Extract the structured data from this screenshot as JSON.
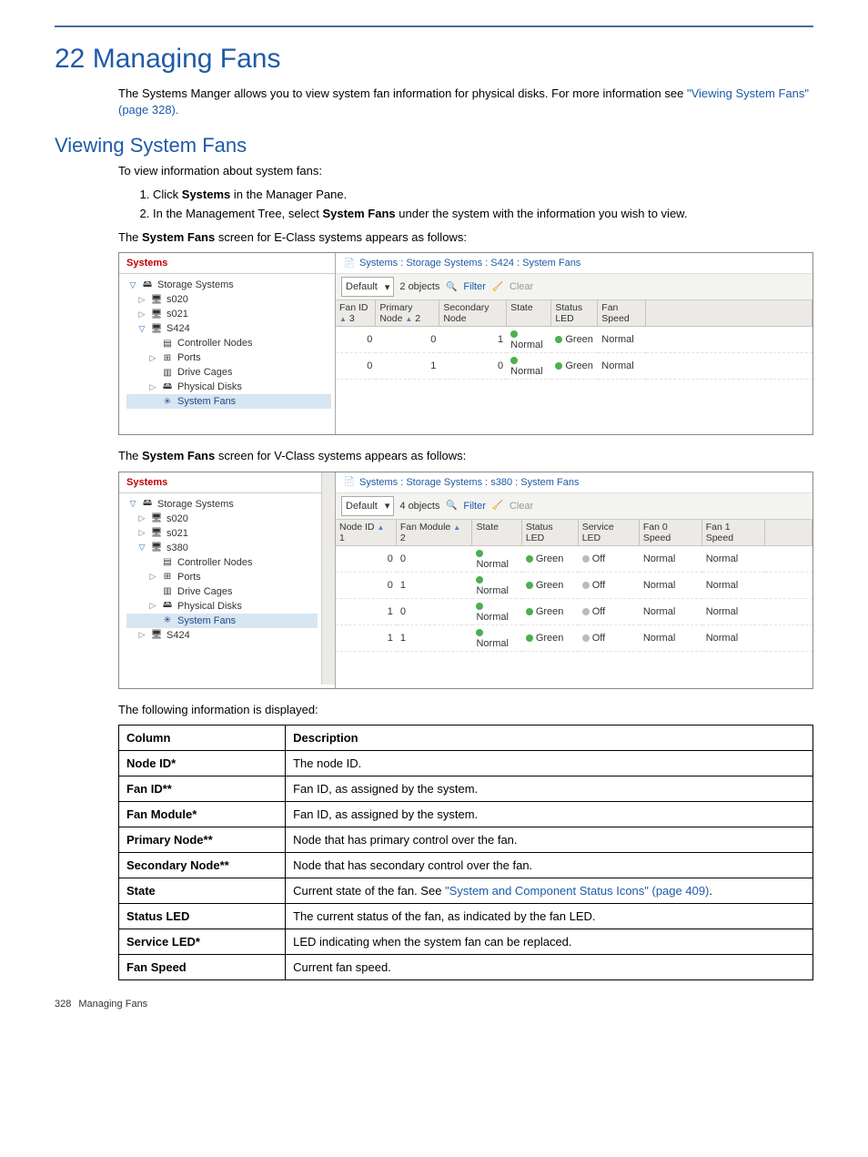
{
  "chapter_title": "22 Managing Fans",
  "intro_text_a": "The Systems Manger allows you to view system fan information for physical disks. For more information see ",
  "intro_link": "\"Viewing System Fans\" (page 328).",
  "section_title": "Viewing System Fans",
  "view_intro": "To view information about system fans:",
  "steps": {
    "s1a": "Click ",
    "s1b": "Systems",
    "s1c": " in the Manager Pane.",
    "s2a": "In the Management Tree, select ",
    "s2b": "System Fans",
    "s2c": " under the system with the information you wish to view."
  },
  "caption_e_a": "The ",
  "caption_e_b": "System Fans",
  "caption_e_c": " screen for E-Class systems appears as follows:",
  "caption_v_a": "The ",
  "caption_v_b": "System Fans",
  "caption_v_c": " screen for V-Class systems appears as follows:",
  "info_displayed": "The following information is displayed:",
  "shot1": {
    "panel_title": "Systems",
    "tree": {
      "root": "Storage Systems",
      "n1": "s020",
      "n2": "s021",
      "n3": "S424",
      "c1": "Controller Nodes",
      "c2": "Ports",
      "c3": "Drive Cages",
      "c4": "Physical Disks",
      "c5": "System Fans"
    },
    "crumb": "Systems : Storage Systems : S424 : System Fans",
    "toolbar": {
      "combo": "Default",
      "objects": "2 objects",
      "filter": "Filter",
      "clear": "Clear"
    },
    "columns": {
      "c0": "Fan ID",
      "c0s": "3",
      "c1": "Primary Node",
      "c1s": "2",
      "c2": "Secondary Node",
      "c3": "State",
      "c4": "Status LED",
      "c5": "Fan Speed"
    },
    "rows": [
      {
        "id": "0",
        "pn": "0",
        "sn": "1",
        "state": "Normal",
        "led": "Green",
        "speed": "Normal"
      },
      {
        "id": "0",
        "pn": "1",
        "sn": "0",
        "state": "Normal",
        "led": "Green",
        "speed": "Normal"
      }
    ]
  },
  "shot2": {
    "panel_title": "Systems",
    "tree": {
      "root": "Storage Systems",
      "n1": "s020",
      "n2": "s021",
      "n3": "s380",
      "c1": "Controller Nodes",
      "c2": "Ports",
      "c3": "Drive Cages",
      "c4": "Physical Disks",
      "c5": "System Fans",
      "n4": "S424"
    },
    "crumb": "Systems : Storage Systems : s380 : System Fans",
    "toolbar": {
      "combo": "Default",
      "objects": "4 objects",
      "filter": "Filter",
      "clear": "Clear"
    },
    "columns": {
      "c0": "Node ID",
      "c0s": "1",
      "c1": "Fan Module",
      "c1s": "2",
      "c2": "State",
      "c3": "Status LED",
      "c4": "Service LED",
      "c5": "Fan 0 Speed",
      "c6": "Fan 1 Speed"
    },
    "rows": [
      {
        "nid": "0",
        "fm": "0",
        "state": "Normal",
        "led": "Green",
        "svc": "Off",
        "f0": "Normal",
        "f1": "Normal"
      },
      {
        "nid": "0",
        "fm": "1",
        "state": "Normal",
        "led": "Green",
        "svc": "Off",
        "f0": "Normal",
        "f1": "Normal"
      },
      {
        "nid": "1",
        "fm": "0",
        "state": "Normal",
        "led": "Green",
        "svc": "Off",
        "f0": "Normal",
        "f1": "Normal"
      },
      {
        "nid": "1",
        "fm": "1",
        "state": "Normal",
        "led": "Green",
        "svc": "Off",
        "f0": "Normal",
        "f1": "Normal"
      }
    ]
  },
  "desc_table": {
    "headers": {
      "h0": "Column",
      "h1": "Description"
    },
    "rows": {
      "r0c0": "Node ID*",
      "r0c1": "The node ID.",
      "r1c0": "Fan ID**",
      "r1c1": "Fan ID, as assigned by the system.",
      "r2c0": "Fan Module*",
      "r2c1": "Fan ID, as assigned by the system.",
      "r3c0": "Primary Node**",
      "r3c1": "Node that has primary control over the fan.",
      "r4c0": "Secondary Node**",
      "r4c1": "Node that has secondary control over the fan.",
      "r5c0": "State",
      "r5c1a": "Current state of the fan. See ",
      "r5c1link": "\"System and Component Status Icons\" (page 409)",
      "r5c1b": ".",
      "r6c0": "Status LED",
      "r6c1": "The current status of the fan, as indicated by the fan LED.",
      "r7c0": "Service LED*",
      "r7c1": "LED indicating when the system fan can be replaced.",
      "r8c0": "Fan Speed",
      "r8c1": "Current fan speed."
    }
  },
  "footer": {
    "page": "328",
    "title": "Managing Fans"
  }
}
